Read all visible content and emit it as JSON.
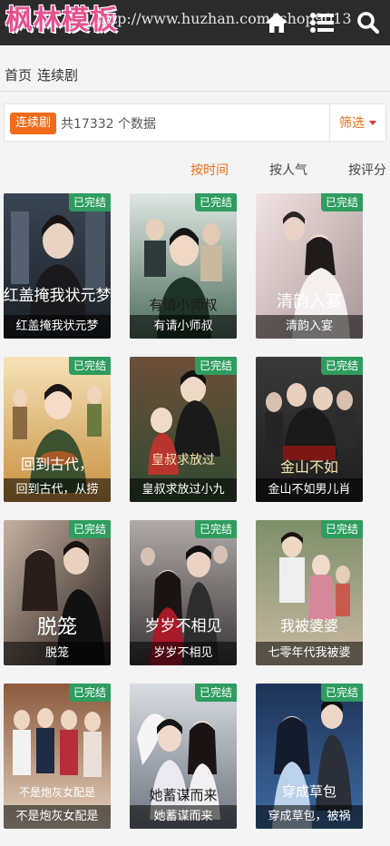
{
  "header": {
    "logo": "枫林模板",
    "url_watermark": "http://www.huzhan.com/ishop9013",
    "icons": [
      "home-icon",
      "list-icon",
      "search-icon"
    ],
    "bg_color": "#2b2b2b",
    "logo_color": "#e6508f"
  },
  "breadcrumb": [
    "首页",
    "连续剧"
  ],
  "filter": {
    "category": "连续剧",
    "count_text": "共17332 个数据",
    "filter_label": "筛选"
  },
  "sort_tabs": [
    {
      "label": "按时间",
      "active": true
    },
    {
      "label": "按人气",
      "active": false
    },
    {
      "label": "按评分",
      "active": false
    }
  ],
  "colors": {
    "accent": "#f26a1a",
    "badge": "#2e9d5f"
  },
  "items": [
    {
      "title": "红盖掩我状元梦",
      "badge": "已完结",
      "poster_text": "红盖掩我状元梦"
    },
    {
      "title": "有请小师叔",
      "badge": "已完结",
      "poster_text": "有请小师叔"
    },
    {
      "title": "清韵入宴",
      "badge": "已完结",
      "poster_text": "清韵入宴"
    },
    {
      "title": "回到古代，从捞",
      "badge": "已完结",
      "poster_text": "回到古代，"
    },
    {
      "title": "皇叔求放过小九",
      "badge": "已完结",
      "poster_text": "皇叔求放过"
    },
    {
      "title": "金山不如男儿肖",
      "badge": "已完结",
      "poster_text": "金山不如"
    },
    {
      "title": "脱笼",
      "badge": "已完结",
      "poster_text": "脱笼"
    },
    {
      "title": "岁岁不相见",
      "badge": "已完结",
      "poster_text": "岁岁不相见"
    },
    {
      "title": "七零年代我被婆",
      "badge": "已完结",
      "poster_text": "我被婆婆"
    },
    {
      "title": "不是炮灰女配是",
      "badge": "已完结",
      "poster_text": "不是炮灰女配是"
    },
    {
      "title": "她蓄谋而来",
      "badge": "已完结",
      "poster_text": "她蓄谋而来"
    },
    {
      "title": "穿成草包，被祸",
      "badge": "已完结",
      "poster_text": "穿成草包"
    }
  ]
}
